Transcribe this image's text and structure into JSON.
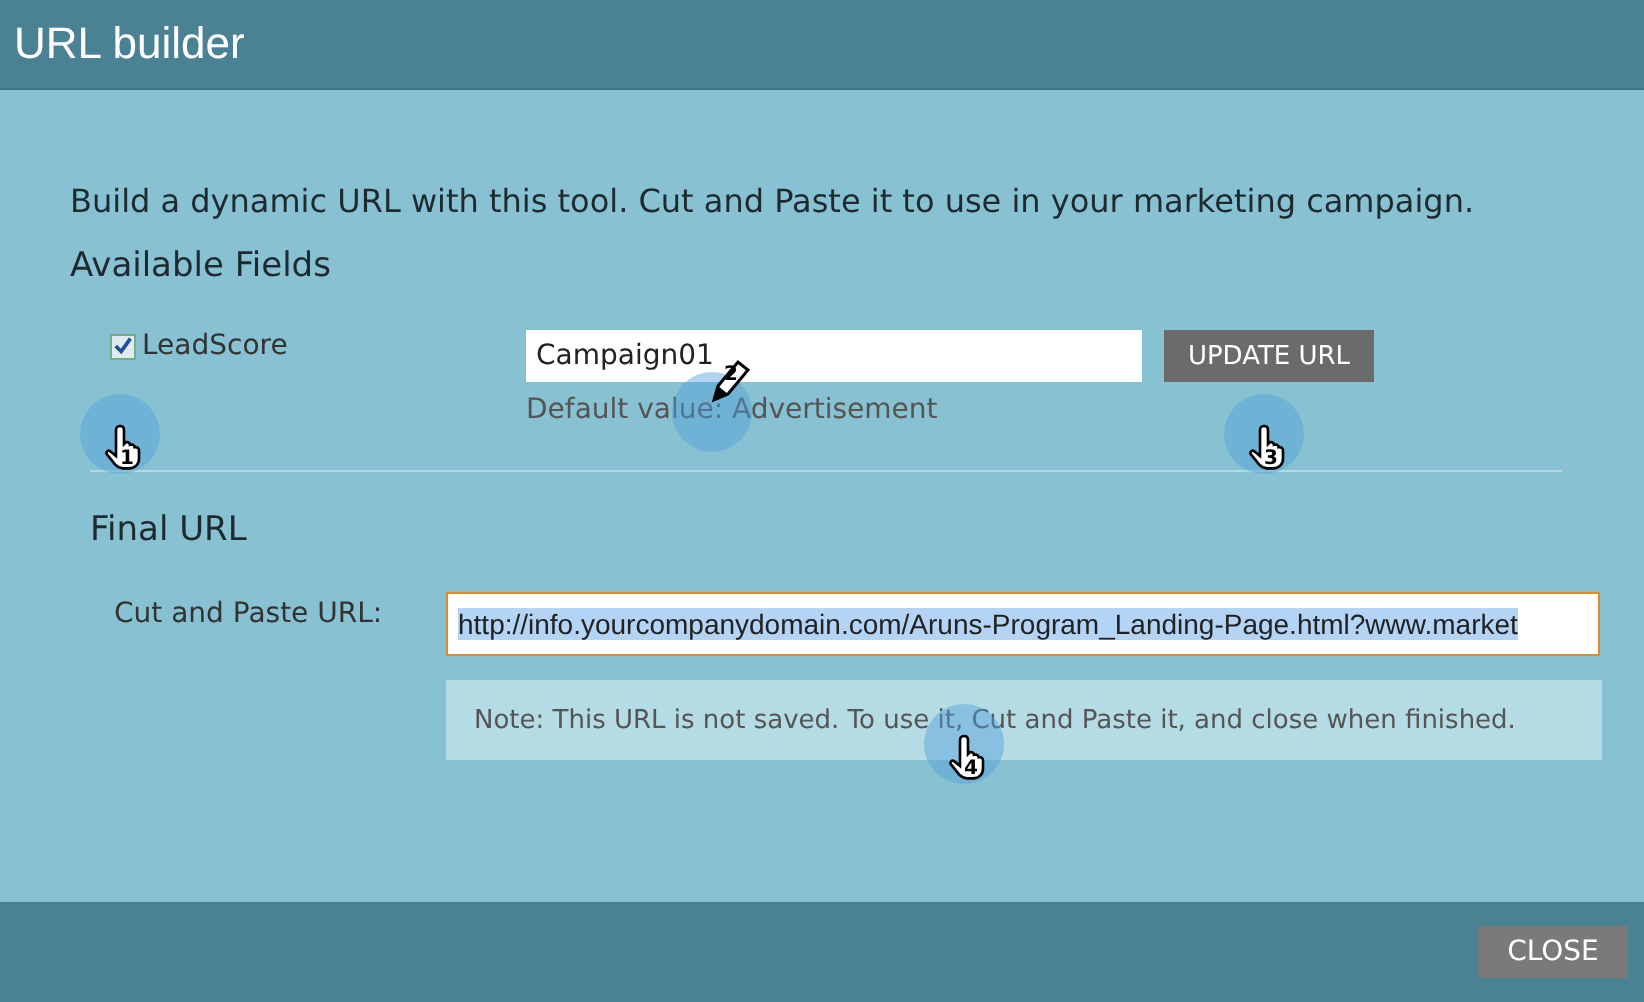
{
  "window": {
    "title": "URL builder"
  },
  "intro": "Build a dynamic URL with this tool. Cut and Paste it to use in your marketing campaign.",
  "available_fields": {
    "heading": "Available Fields",
    "field": {
      "label": "LeadScore",
      "checked": true,
      "value": "Campaign01",
      "hint": "Default value: Advertisement"
    },
    "update_button": "UPDATE URL"
  },
  "final_url": {
    "heading": "Final URL",
    "label": "Cut and Paste URL:",
    "value": "http://info.yourcompanydomain.com/Aruns-Program_Landing-Page.html?www.market",
    "selected": true,
    "note": "Note: This URL is not saved. To use it, Cut and Paste it, and close when finished."
  },
  "footer": {
    "close_button": "CLOSE"
  },
  "steps": [
    {
      "number": "1",
      "kind": "hand"
    },
    {
      "number": "2",
      "kind": "pencil"
    },
    {
      "number": "3",
      "kind": "hand"
    },
    {
      "number": "4",
      "kind": "hand"
    }
  ]
}
